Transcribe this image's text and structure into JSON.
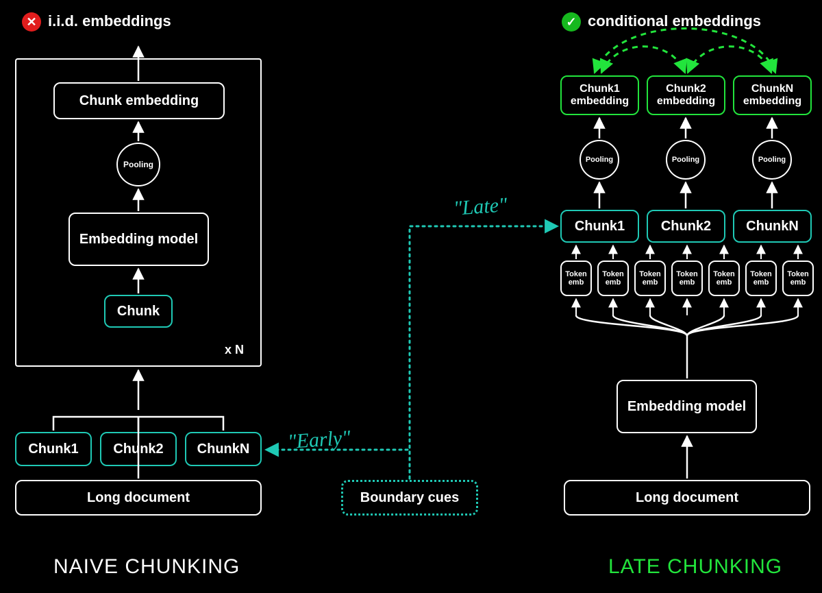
{
  "diagram": {
    "badges": {
      "x": "✕",
      "check": "✓"
    },
    "left": {
      "header": "i.i.d. embeddings",
      "outer": {
        "top_box": "Chunk embedding",
        "pooling": "Pooling",
        "model": "Embedding model",
        "chunk": "Chunk",
        "xn": "x N"
      },
      "chunks": [
        "Chunk1",
        "Chunk2",
        "ChunkN"
      ],
      "doc": "Long document",
      "caption": "NAIVE CHUNKING"
    },
    "right": {
      "header": "conditional embeddings",
      "outputs": [
        "Chunk1 embedding",
        "Chunk2 embedding",
        "ChunkN embedding"
      ],
      "pooling": "Pooling",
      "chunks": [
        "Chunk1",
        "Chunk2",
        "ChunkN"
      ],
      "token_emb": "Token emb",
      "model": "Embedding model",
      "doc": "Long document",
      "caption": "LATE CHUNKING"
    },
    "center": {
      "boundary": "Boundary cues",
      "early": "\"Early\"",
      "late": "\"Late\""
    }
  }
}
